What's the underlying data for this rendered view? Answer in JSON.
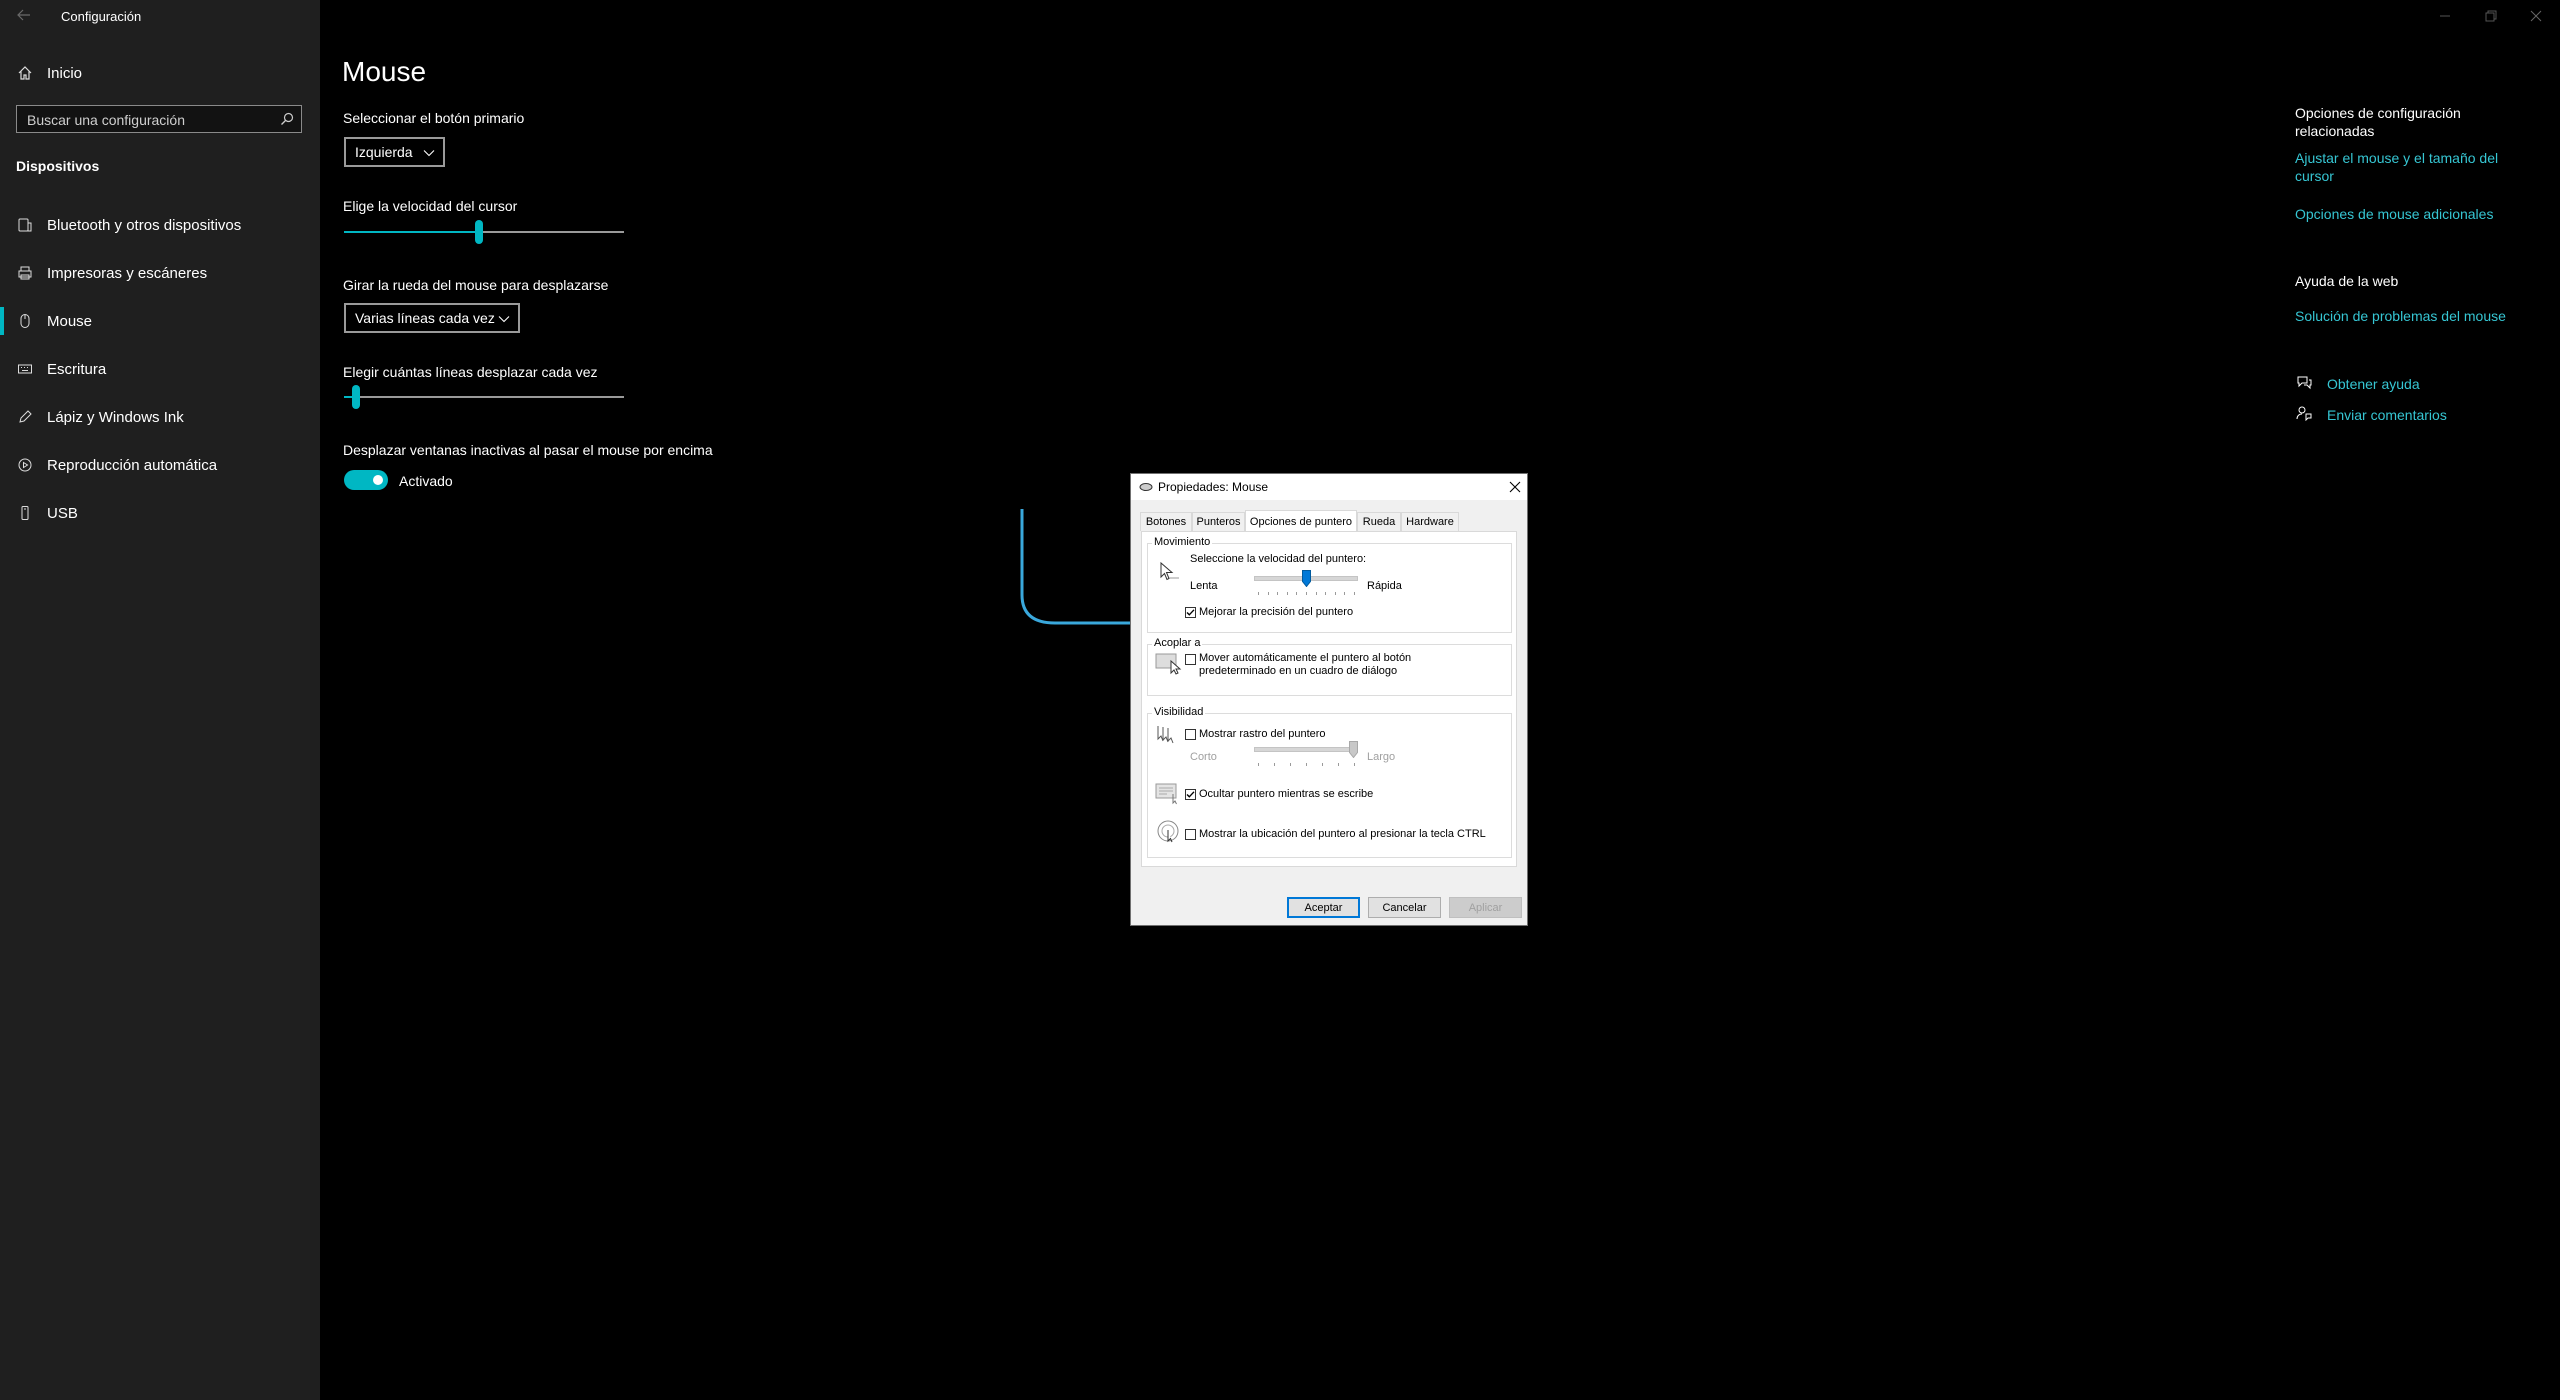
{
  "window": {
    "app_title": "Configuración"
  },
  "sidebar": {
    "home_label": "Inicio",
    "search_placeholder": "Buscar una configuración",
    "section_title": "Dispositivos",
    "items": [
      {
        "label": "Bluetooth y otros dispositivos",
        "icon": "bluetooth-devices-icon"
      },
      {
        "label": "Impresoras y escáneres",
        "icon": "printer-icon"
      },
      {
        "label": "Mouse",
        "icon": "mouse-icon",
        "active": true
      },
      {
        "label": "Escritura",
        "icon": "keyboard-icon"
      },
      {
        "label": "Lápiz y Windows Ink",
        "icon": "pen-icon"
      },
      {
        "label": "Reproducción automática",
        "icon": "autoplay-icon"
      },
      {
        "label": "USB",
        "icon": "usb-icon"
      }
    ]
  },
  "main": {
    "page_title": "Mouse",
    "primary_button_label": "Seleccionar el botón primario",
    "primary_button_value": "Izquierda",
    "cursor_speed_label": "Elige la velocidad del cursor",
    "cursor_speed_value": 0.48,
    "scroll_wheel_label": "Girar la rueda del mouse para desplazarse",
    "scroll_wheel_value": "Varias líneas cada vez",
    "scroll_lines_label": "Elegir cuántas líneas desplazar cada vez",
    "scroll_lines_value": 0.03,
    "inactive_scroll_label": "Desplazar ventanas inactivas al pasar el mouse por encima",
    "inactive_scroll_state": "Activado"
  },
  "related": {
    "title": "Opciones de configuración relacionadas",
    "link1": "Ajustar el mouse y el tamaño del cursor",
    "link2": "Opciones de mouse adicionales",
    "web_help_title": "Ayuda de la web",
    "link3": "Solución de problemas del mouse",
    "get_help": "Obtener ayuda",
    "feedback": "Enviar comentarios"
  },
  "dialog": {
    "title": "Propiedades: Mouse",
    "tabs": [
      "Botones",
      "Punteros",
      "Opciones de puntero",
      "Rueda",
      "Hardware"
    ],
    "active_tab": "Opciones de puntero",
    "movement": {
      "title": "Movimiento",
      "speed_label": "Seleccione la velocidad del puntero:",
      "slow": "Lenta",
      "fast": "Rápida",
      "speed_value": 0.5,
      "precision_label": "Mejorar la precisión del puntero",
      "precision_checked": true
    },
    "snap": {
      "title": "Acoplar a",
      "label_line1": "Mover automáticamente el puntero al botón",
      "label_line2": "predeterminado en un cuadro de diálogo",
      "checked": false
    },
    "visibility": {
      "title": "Visibilidad",
      "trails_label": "Mostrar rastro del puntero",
      "trails_checked": false,
      "short": "Corto",
      "long": "Largo",
      "trails_value": 1.0,
      "hide_label": "Ocultar puntero mientras se escribe",
      "hide_checked": true,
      "ctrl_label": "Mostrar la ubicación del puntero al presionar la tecla CTRL",
      "ctrl_checked": false
    },
    "buttons": {
      "ok": "Aceptar",
      "cancel": "Cancelar",
      "apply": "Aplicar"
    }
  },
  "colors": {
    "accent": "#00b7c3",
    "link": "#36c6d3",
    "sidebar_bg": "#1f1f1f",
    "arrow": "#3aa8dc"
  }
}
